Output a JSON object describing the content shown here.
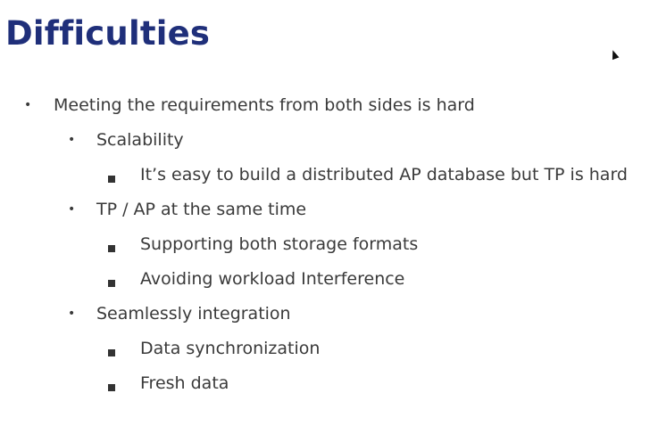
{
  "slide": {
    "title": "Difficulties",
    "level1": {
      "text": "Meeting the requirements from both sides is hard"
    },
    "groups": [
      {
        "heading": "Scalability",
        "items": [
          "It’s easy to build a distributed AP database but TP is hard"
        ]
      },
      {
        "heading": "TP / AP at the same time",
        "items": [
          "Supporting both storage formats",
          "Avoiding workload Interference"
        ]
      },
      {
        "heading": "Seamlessly integration",
        "items": [
          "Data synchronization",
          "Fresh data"
        ]
      }
    ]
  },
  "icons": {
    "level1_bullet": "dot-bullet",
    "level2_bullet": "dot-bullet",
    "level3_bullet": "square-bullet",
    "cursor": "mouse-pointer-icon"
  },
  "colors": {
    "title": "#1f2f7a",
    "text": "#3a3a3a",
    "background": "#ffffff"
  }
}
